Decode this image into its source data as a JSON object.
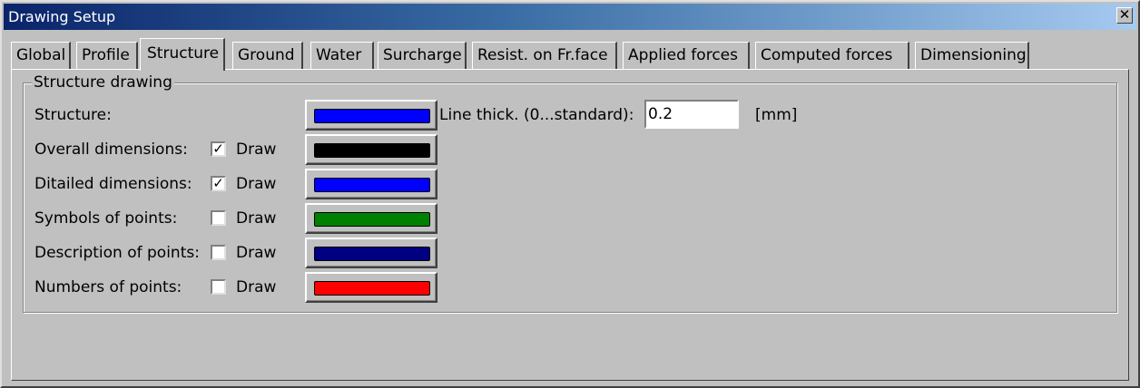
{
  "window": {
    "title": "Drawing Setup"
  },
  "tabs": [
    {
      "label": "Global"
    },
    {
      "label": "Profile"
    },
    {
      "label": "Structure"
    },
    {
      "label": "Ground"
    },
    {
      "label": "Water"
    },
    {
      "label": "Surcharge"
    },
    {
      "label": "Resist. on Fr.face"
    },
    {
      "label": "Applied forces"
    },
    {
      "label": "Computed forces"
    },
    {
      "label": "Dimensioning"
    }
  ],
  "active_tab": "Structure",
  "group": {
    "title": "Structure drawing",
    "rows": [
      {
        "label": "Structure:",
        "has_checkbox": false,
        "checked": false,
        "draw_label": "",
        "color": "#0000ff"
      },
      {
        "label": "Overall dimensions:",
        "has_checkbox": true,
        "checked": true,
        "draw_label": "Draw",
        "color": "#000000"
      },
      {
        "label": "Ditailed dimensions:",
        "has_checkbox": true,
        "checked": true,
        "draw_label": "Draw",
        "color": "#0000ff"
      },
      {
        "label": "Symbols of points:",
        "has_checkbox": true,
        "checked": false,
        "draw_label": "Draw",
        "color": "#008000"
      },
      {
        "label": "Description of points:",
        "has_checkbox": true,
        "checked": false,
        "draw_label": "Draw",
        "color": "#000080"
      },
      {
        "label": "Numbers of points:",
        "has_checkbox": true,
        "checked": false,
        "draw_label": "Draw",
        "color": "#ff0000"
      }
    ]
  },
  "line_thickness": {
    "label": "Line thick. (0...standard):",
    "value": "0.2",
    "unit": "[mm]"
  },
  "icons": {
    "close": "close-icon",
    "check": "check-mark-icon"
  }
}
